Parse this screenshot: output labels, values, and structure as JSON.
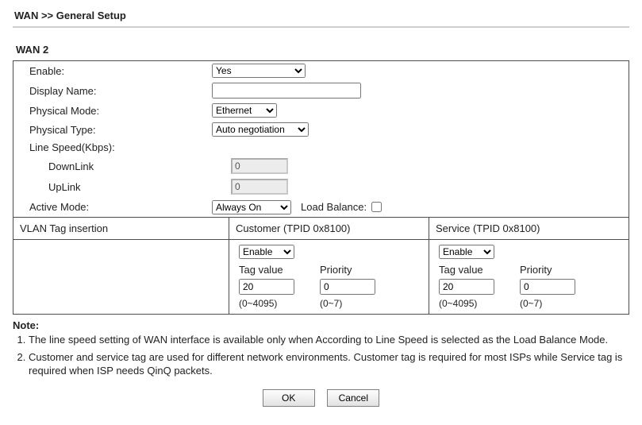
{
  "header": {
    "title": "WAN >> General Setup"
  },
  "section": {
    "title": "WAN 2"
  },
  "fields": {
    "enable_label": "Enable:",
    "enable_value": "Yes",
    "display_name_label": "Display Name:",
    "display_name_value": "",
    "physical_mode_label": "Physical Mode:",
    "physical_mode_value": "Ethernet",
    "physical_type_label": "Physical Type:",
    "physical_type_value": "Auto negotiation",
    "line_speed_label": "Line Speed(Kbps):",
    "downlink_label": "DownLink",
    "downlink_value": "0",
    "uplink_label": "UpLink",
    "uplink_value": "0",
    "active_mode_label": "Active Mode:",
    "active_mode_value": "Always On",
    "load_balance_label": "Load Balance:",
    "load_balance_checked": false
  },
  "vlan": {
    "row_label": "VLAN Tag insertion",
    "customer": {
      "header": "Customer (TPID 0x8100)",
      "enable": "Enable",
      "tag_label": "Tag value",
      "tag_value": "20",
      "tag_range": "(0~4095)",
      "prio_label": "Priority",
      "prio_value": "0",
      "prio_range": "(0~7)"
    },
    "service": {
      "header": "Service (TPID 0x8100)",
      "enable": "Enable",
      "tag_label": "Tag value",
      "tag_value": "20",
      "tag_range": "(0~4095)",
      "prio_label": "Priority",
      "prio_value": "0",
      "prio_range": "(0~7)"
    }
  },
  "notes": {
    "title": "Note:",
    "items": [
      "The line speed setting of WAN interface is available only when According to Line Speed is selected as the Load Balance Mode.",
      "Customer and service tag are used for different network environments. Customer tag is required for most ISPs while Service tag is required when ISP needs QinQ packets."
    ]
  },
  "buttons": {
    "ok": "OK",
    "cancel": "Cancel"
  }
}
